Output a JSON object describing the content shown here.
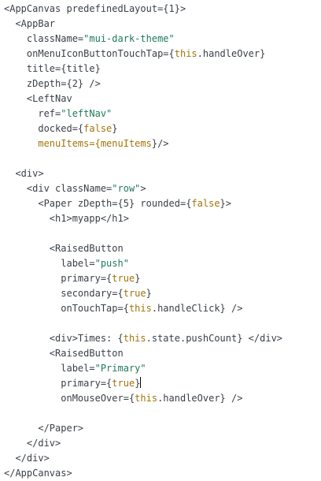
{
  "editor": {
    "lines": [
      [
        {
          "t": "<AppCanvas predefinedLayout={1}>",
          "c": "tag"
        }
      ],
      [
        {
          "t": "  <AppBar",
          "c": "tag"
        }
      ],
      [
        {
          "t": "    className=",
          "c": "attr"
        },
        {
          "t": "\"mui-dark-theme\"",
          "c": "str"
        }
      ],
      [
        {
          "t": "    onMenuIconButtonTouchTap={",
          "c": "attr"
        },
        {
          "t": "this",
          "c": "kw"
        },
        {
          "t": ".handleOver}",
          "c": "attr"
        }
      ],
      [
        {
          "t": "    title={title}",
          "c": "attr"
        }
      ],
      [
        {
          "t": "    zDepth={2} />",
          "c": "attr"
        }
      ],
      [
        {
          "t": "    <LeftNav",
          "c": "tag"
        }
      ],
      [
        {
          "t": "      ref=",
          "c": "attr"
        },
        {
          "t": "\"leftNav\"",
          "c": "str"
        }
      ],
      [
        {
          "t": "      docked={",
          "c": "attr"
        },
        {
          "t": "false",
          "c": "kw"
        },
        {
          "t": "}",
          "c": "attr"
        }
      ],
      [
        {
          "t": "      menuItems={",
          "c": "kw"
        },
        {
          "t": "menuItems",
          "c": "kw"
        },
        {
          "t": "}/>",
          "c": "attr"
        }
      ],
      [],
      [
        {
          "t": "  <div>",
          "c": "tag"
        }
      ],
      [
        {
          "t": "    <div className=",
          "c": "tag"
        },
        {
          "t": "\"row\"",
          "c": "str"
        },
        {
          "t": ">",
          "c": "tag"
        }
      ],
      [
        {
          "t": "      <Paper zDepth={5} rounded={",
          "c": "tag"
        },
        {
          "t": "false",
          "c": "kw"
        },
        {
          "t": "}>",
          "c": "tag"
        }
      ],
      [
        {
          "t": "        <h1>myapp</h1>",
          "c": "tag"
        }
      ],
      [],
      [
        {
          "t": "        <RaisedButton",
          "c": "tag"
        }
      ],
      [
        {
          "t": "          label=",
          "c": "attr"
        },
        {
          "t": "\"push\"",
          "c": "str"
        }
      ],
      [
        {
          "t": "          primary={",
          "c": "attr"
        },
        {
          "t": "true",
          "c": "kw"
        },
        {
          "t": "}",
          "c": "attr"
        }
      ],
      [
        {
          "t": "          secondary={",
          "c": "attr"
        },
        {
          "t": "true",
          "c": "kw"
        },
        {
          "t": "}",
          "c": "attr"
        }
      ],
      [
        {
          "t": "          onTouchTap={",
          "c": "attr"
        },
        {
          "t": "this",
          "c": "kw"
        },
        {
          "t": ".handleClick} />",
          "c": "attr"
        }
      ],
      [],
      [
        {
          "t": "        <div>Times: {",
          "c": "tag"
        },
        {
          "t": "this",
          "c": "kw"
        },
        {
          "t": ".state.pushCount} </div>",
          "c": "tag"
        }
      ],
      [
        {
          "t": "        <RaisedButton",
          "c": "tag"
        }
      ],
      [
        {
          "t": "          label=",
          "c": "attr"
        },
        {
          "t": "\"Primary\"",
          "c": "str"
        }
      ],
      [
        {
          "t": "          primary={",
          "c": "attr"
        },
        {
          "t": "true",
          "c": "kw"
        },
        {
          "t": "}",
          "c": "attr"
        },
        {
          "caret": true
        }
      ],
      [
        {
          "t": "          onMouseOver={",
          "c": "attr"
        },
        {
          "t": "this",
          "c": "kw"
        },
        {
          "t": ".handleOver} />",
          "c": "attr"
        }
      ],
      [],
      [
        {
          "t": "      </Paper>",
          "c": "tag"
        }
      ],
      [
        {
          "t": "    </div>",
          "c": "tag"
        }
      ],
      [
        {
          "t": "  </div>",
          "c": "tag"
        }
      ],
      [
        {
          "t": "</AppCanvas>",
          "c": "tag"
        }
      ]
    ]
  }
}
